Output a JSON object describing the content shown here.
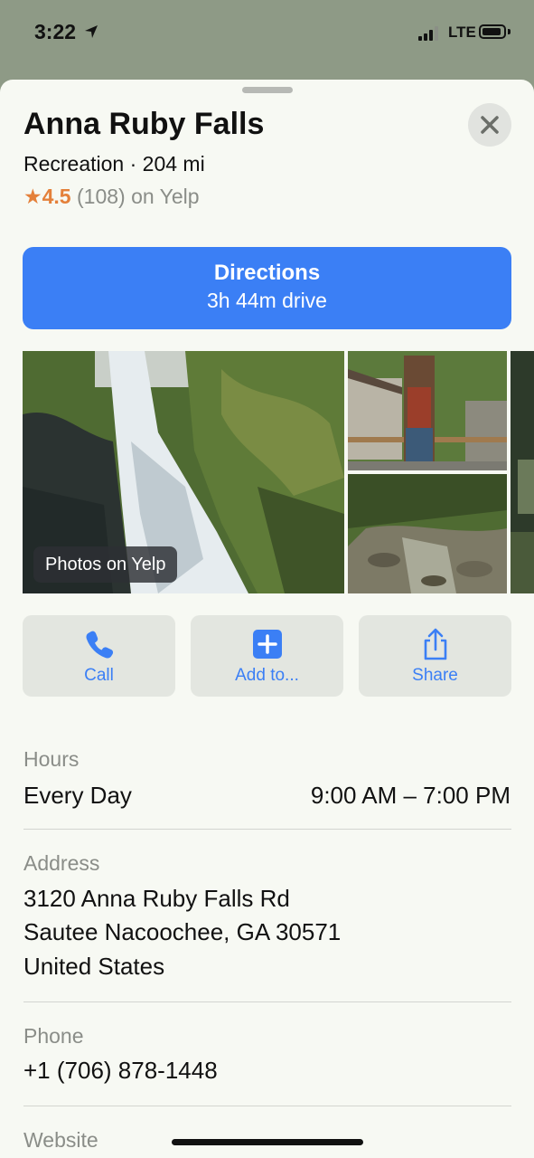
{
  "status_bar": {
    "time": "3:22",
    "network": "LTE"
  },
  "place": {
    "name": "Anna Ruby Falls",
    "subtitle": "Recreation · 204 mi",
    "rating_star": "★",
    "rating_score": "4.5",
    "rating_rest": " (108) on Yelp"
  },
  "directions": {
    "label": "Directions",
    "duration": "3h 44m drive"
  },
  "photos": {
    "badge": "Photos on Yelp"
  },
  "actions": [
    {
      "label": "Call",
      "icon": "phone-icon"
    },
    {
      "label": "Add to...",
      "icon": "plus-square-icon"
    },
    {
      "label": "Share",
      "icon": "share-icon"
    }
  ],
  "hours": {
    "label": "Hours",
    "day": "Every Day",
    "time": "9:00 AM – 7:00 PM"
  },
  "address": {
    "label": "Address",
    "line1": "3120 Anna Ruby Falls Rd",
    "line2": "Sautee Nacoochee, GA 30571",
    "line3": "United States"
  },
  "phone": {
    "label": "Phone",
    "number": "+1 (706) 878-1448"
  },
  "website": {
    "label": "Website"
  },
  "colors": {
    "accent": "#3b7ff5",
    "rating": "#e4803a",
    "sheet_bg": "#f7f9f3"
  }
}
